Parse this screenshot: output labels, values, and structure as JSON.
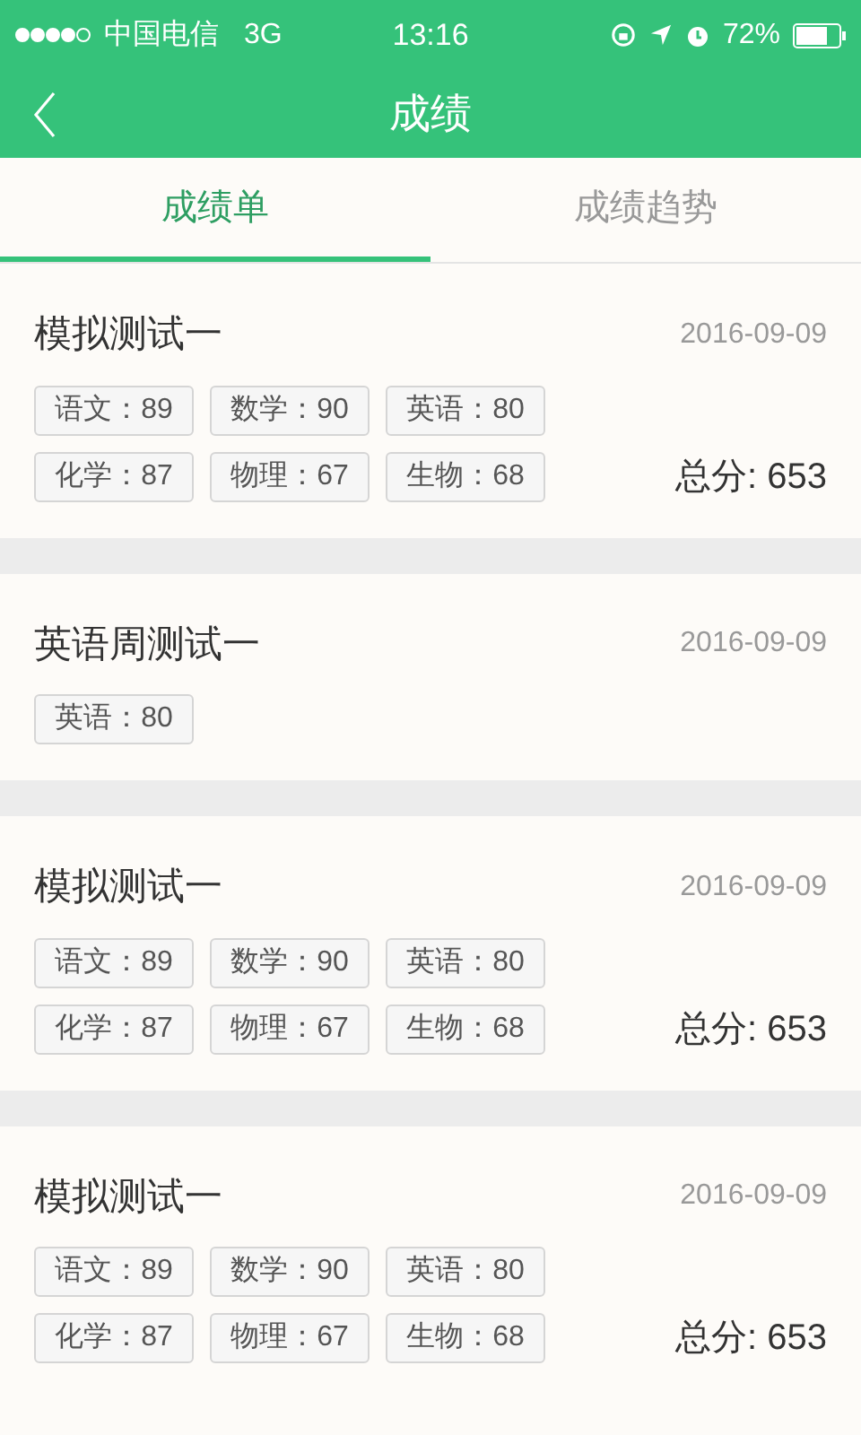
{
  "status_bar": {
    "carrier": "中国电信",
    "network": "3G",
    "time": "13:16",
    "battery": "72%"
  },
  "nav": {
    "title": "成绩"
  },
  "tabs": [
    {
      "label": "成绩单",
      "selected": true
    },
    {
      "label": "成绩趋势",
      "selected": false
    }
  ],
  "cards": [
    {
      "title": "模拟测试一",
      "date": "2016-09-09",
      "scores": [
        "语文：89",
        "数学：90",
        "英语：80",
        "化学：87",
        "物理：67",
        "生物：68"
      ],
      "total": "总分: 653"
    },
    {
      "title": "英语周测试一",
      "date": "2016-09-09",
      "scores": [
        "英语：80"
      ]
    },
    {
      "title": "模拟测试一",
      "date": "2016-09-09",
      "scores": [
        "语文：89",
        "数学：90",
        "英语：80",
        "化学：87",
        "物理：67",
        "生物：68"
      ],
      "total": "总分: 653"
    },
    {
      "title": "模拟测试一",
      "date": "2016-09-09",
      "scores": [
        "语文：89",
        "数学：90",
        "英语：80",
        "化学：87",
        "物理：67",
        "生物：68"
      ],
      "total": "总分: 653"
    }
  ]
}
